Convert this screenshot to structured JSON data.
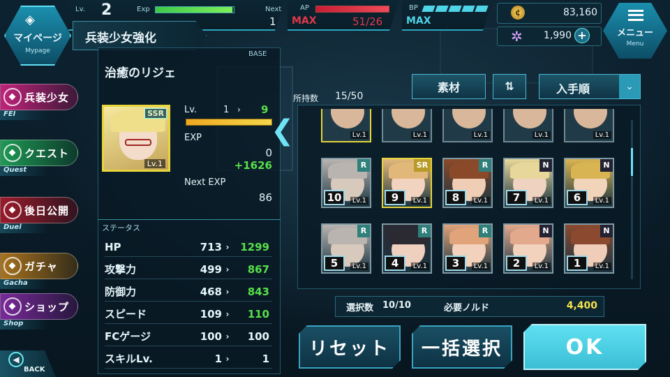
{
  "header": {
    "lv_label": "Lv.",
    "lv_value": "2",
    "exp_label": "Exp",
    "next_label": "Next",
    "next_value": "1",
    "exp_fill": 0.98,
    "ap_label": "AP",
    "ap_max_label": "MAX",
    "ap_value": "51/26",
    "ap_fill": 1.0,
    "bp_label": "BP",
    "bp_max_label": "MAX",
    "bp_segments": 5,
    "gold": "83,160",
    "gems": "1,990"
  },
  "mypage": {
    "label": "マイページ",
    "sub": "Mypage"
  },
  "menu": {
    "label": "メニュー",
    "sub": "Menu"
  },
  "screen_title": "兵装少女強化",
  "base_label": "BASE",
  "character": {
    "name": "治癒のリジェ",
    "rarity": "SSR",
    "card_level": "Lv.1",
    "lv_label": "Lv.",
    "lv_current": "1",
    "lv_next": "9",
    "exp_label": "EXP",
    "exp_value": "0",
    "exp_gain": "+1626",
    "next_exp_label": "Next EXP",
    "next_exp_value": "86"
  },
  "status": {
    "label": "ステータス",
    "rows": [
      {
        "label": "HP",
        "current": "713",
        "next": "1299",
        "up": true
      },
      {
        "label": "攻撃力",
        "current": "499",
        "next": "867",
        "up": true
      },
      {
        "label": "防御力",
        "current": "468",
        "next": "843",
        "up": true
      },
      {
        "label": "スピード",
        "current": "109",
        "next": "110",
        "up": true
      },
      {
        "label": "FCゲージ",
        "current": "100",
        "next": "100",
        "up": false
      },
      {
        "label": "スキルLv.",
        "current": "1",
        "next": "1",
        "up": false
      }
    ]
  },
  "sidenav": [
    {
      "label": "兵装少女",
      "sub": "FEI",
      "color": "#c0237a"
    },
    {
      "label": "クエスト",
      "sub": "Quest",
      "color": "#1f9a54"
    },
    {
      "label": "後日公開",
      "sub": "Duel",
      "color": "#9a1b2b"
    },
    {
      "label": "ガチャ",
      "sub": "Gacha",
      "color": "#a8731e"
    },
    {
      "label": "ショップ",
      "sub": "Shop",
      "color": "#7a2a9a"
    }
  ],
  "back": {
    "label": "BACK"
  },
  "inventory": {
    "count_label": "所持数",
    "count_value": "15/50",
    "filter_label": "素材",
    "sort_label": "入手順",
    "partial_row": [
      "Lv.1",
      "Lv.1",
      "Lv.1",
      "Lv.1",
      "Lv.1"
    ],
    "cards": [
      {
        "num": "10",
        "rarity": "R",
        "level": "Lv.1",
        "skin": "#d8c9bd",
        "hair": "#b9b4b0"
      },
      {
        "num": "9",
        "rarity": "SR",
        "level": "Lv.1",
        "skin": "#f2d3bf",
        "hair": "#e2b87a"
      },
      {
        "num": "8",
        "rarity": "R",
        "level": "Lv.1",
        "skin": "#f0cdb5",
        "hair": "#8a4a2a"
      },
      {
        "num": "7",
        "rarity": "N",
        "level": "Lv.1",
        "skin": "#efd2c0",
        "hair": "#e8d79a"
      },
      {
        "num": "6",
        "rarity": "N",
        "level": "Lv.1",
        "skin": "#f2d4bb",
        "hair": "#d9b452"
      },
      {
        "num": "5",
        "rarity": "R",
        "level": "Lv.1",
        "skin": "#d8c9bd",
        "hair": "#b9b4b0"
      },
      {
        "num": "4",
        "rarity": "R",
        "level": "Lv.1",
        "skin": "#efcfbd",
        "hair": "#2b2a33"
      },
      {
        "num": "3",
        "rarity": "R",
        "level": "Lv.1",
        "skin": "#f2d2bc",
        "hair": "#e0a37a"
      },
      {
        "num": "2",
        "rarity": "N",
        "level": "Lv.1",
        "skin": "#f2d2bc",
        "hair": "#e2a98c"
      },
      {
        "num": "1",
        "rarity": "N",
        "level": "Lv.1",
        "skin": "#efcdb8",
        "hair": "#8b4a2f"
      }
    ]
  },
  "selection": {
    "label": "選択数",
    "value": "10/10",
    "cost_label": "必要ノルド",
    "cost_value": "4,400"
  },
  "buttons": {
    "reset": "リセット",
    "select_all": "一括選択",
    "ok": "OK"
  },
  "colors": {
    "accent": "#2aa7c0",
    "green": "#58e04a",
    "ap_red": "#e0384a",
    "ok_bg": "#4fd3e6",
    "gold": "#f5e24a"
  }
}
